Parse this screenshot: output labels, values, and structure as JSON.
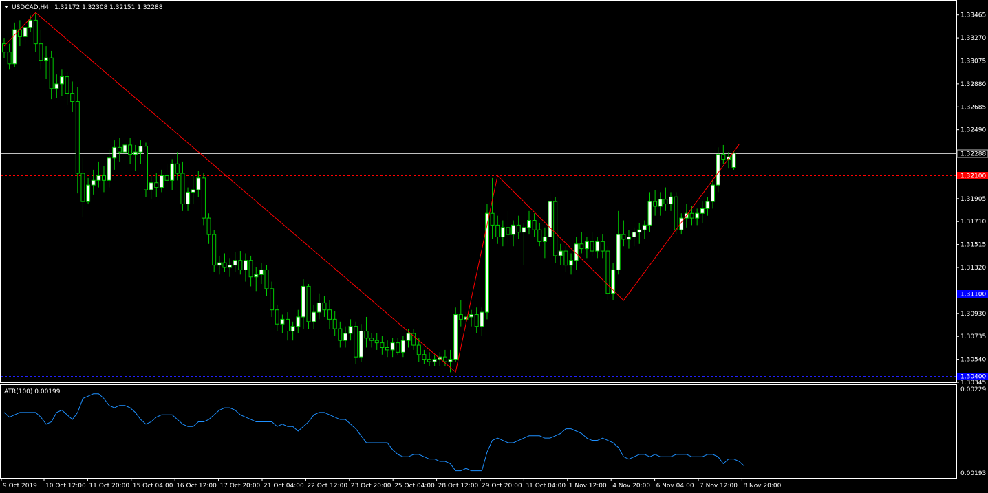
{
  "header": {
    "symbol_timeframe": "USDCAD,H4",
    "ohlc": "1.32172 1.32308 1.32151 1.32288"
  },
  "indicator": {
    "label": "ATR(100) 0.00199"
  },
  "price_levels": {
    "current_bid": "1.32288",
    "red_level": "1.32100",
    "blue_upper": "1.31100",
    "blue_lower": "1.30400"
  },
  "colors": {
    "background": "#000000",
    "frame": "#ffffff",
    "bull_candle": "#ffffff",
    "bear_candle": "#000000",
    "wick": "#00cc00",
    "zigzag": "#ff0000",
    "bid_line": "#c0c0c0",
    "red_level_line": "#ff0000",
    "blue_level_line": "#0000ff",
    "atr_line": "#1e90ff"
  },
  "chart_data": [
    {
      "type": "candlestick",
      "symbol": "USDCAD",
      "timeframe": "H4",
      "price_axis": {
        "range": [
          1.30345,
          1.3358
        ],
        "tick_labels": [
          "1.33465",
          "1.33270",
          "1.33075",
          "1.32880",
          "1.32685",
          "1.32490",
          "1.31905",
          "1.31710",
          "1.31515",
          "1.31320",
          "1.30930",
          "1.30735",
          "1.30540",
          "1.30345"
        ]
      },
      "time_axis": {
        "tick_labels": [
          "9 Oct 2019",
          "10 Oct 12:00",
          "11 Oct 20:00",
          "15 Oct 04:00",
          "16 Oct 12:00",
          "17 Oct 20:00",
          "21 Oct 04:00",
          "22 Oct 12:00",
          "23 Oct 20:00",
          "25 Oct 04:00",
          "28 Oct 12:00",
          "29 Oct 20:00",
          "31 Oct 04:00",
          "1 Nov 12:00",
          "4 Nov 20:00",
          "6 Nov 04:00",
          "7 Nov 12:00",
          "8 Nov 20:00"
        ]
      },
      "candles": [
        [
          1.3322,
          1.3327,
          1.331,
          1.3315
        ],
        [
          1.3315,
          1.3322,
          1.33,
          1.3305
        ],
        [
          1.3305,
          1.334,
          1.3302,
          1.3334
        ],
        [
          1.3334,
          1.3342,
          1.332,
          1.3328
        ],
        [
          1.3328,
          1.3342,
          1.3322,
          1.3336
        ],
        [
          1.3336,
          1.3346,
          1.3332,
          1.3342
        ],
        [
          1.3342,
          1.3348,
          1.3315,
          1.3322
        ],
        [
          1.3322,
          1.3334,
          1.33,
          1.3308
        ],
        [
          1.3308,
          1.332,
          1.3292,
          1.331
        ],
        [
          1.331,
          1.3316,
          1.3275,
          1.3284
        ],
        [
          1.3284,
          1.3296,
          1.3276,
          1.3288
        ],
        [
          1.3288,
          1.33,
          1.3278,
          1.3294
        ],
        [
          1.3294,
          1.3298,
          1.327,
          1.328
        ],
        [
          1.328,
          1.329,
          1.3264,
          1.3273
        ],
        [
          1.3273,
          1.3285,
          1.3195,
          1.3212
        ],
        [
          1.3212,
          1.3225,
          1.3175,
          1.3188
        ],
        [
          1.3188,
          1.3208,
          1.3186,
          1.3202
        ],
        [
          1.3202,
          1.3215,
          1.3194,
          1.3206
        ],
        [
          1.3206,
          1.3222,
          1.32,
          1.321
        ],
        [
          1.321,
          1.3218,
          1.3196,
          1.3206
        ],
        [
          1.3206,
          1.3232,
          1.32,
          1.3225
        ],
        [
          1.3225,
          1.324,
          1.3215,
          1.3234
        ],
        [
          1.3234,
          1.3242,
          1.3222,
          1.323
        ],
        [
          1.323,
          1.324,
          1.3222,
          1.3236
        ],
        [
          1.3236,
          1.3242,
          1.322,
          1.3228
        ],
        [
          1.3228,
          1.3236,
          1.3214,
          1.323
        ],
        [
          1.323,
          1.324,
          1.322,
          1.3235
        ],
        [
          1.3235,
          1.3238,
          1.3192,
          1.3198
        ],
        [
          1.3198,
          1.321,
          1.319,
          1.3204
        ],
        [
          1.3204,
          1.3212,
          1.3192,
          1.32
        ],
        [
          1.32,
          1.3215,
          1.3196,
          1.321
        ],
        [
          1.321,
          1.322,
          1.32,
          1.3206
        ],
        [
          1.3206,
          1.3224,
          1.3198,
          1.322
        ],
        [
          1.322,
          1.323,
          1.3206,
          1.3212
        ],
        [
          1.3212,
          1.3222,
          1.318,
          1.3186
        ],
        [
          1.3186,
          1.32,
          1.318,
          1.3196
        ],
        [
          1.3196,
          1.321,
          1.3186,
          1.3198
        ],
        [
          1.3198,
          1.3214,
          1.3192,
          1.3208
        ],
        [
          1.3208,
          1.3212,
          1.3168,
          1.3174
        ],
        [
          1.3174,
          1.3178,
          1.3152,
          1.316
        ],
        [
          1.316,
          1.3164,
          1.3128,
          1.3134
        ],
        [
          1.3134,
          1.3142,
          1.3126,
          1.3136
        ],
        [
          1.3136,
          1.3144,
          1.3128,
          1.3132
        ],
        [
          1.3132,
          1.314,
          1.3124,
          1.3134
        ],
        [
          1.3134,
          1.3145,
          1.3128,
          1.3138
        ],
        [
          1.3138,
          1.3146,
          1.3126,
          1.313
        ],
        [
          1.313,
          1.3144,
          1.312,
          1.3138
        ],
        [
          1.3138,
          1.3142,
          1.3116,
          1.3124
        ],
        [
          1.3124,
          1.3132,
          1.3112,
          1.3126
        ],
        [
          1.3126,
          1.3136,
          1.3118,
          1.313
        ],
        [
          1.313,
          1.3134,
          1.3108,
          1.3114
        ],
        [
          1.3114,
          1.312,
          1.309,
          1.3096
        ],
        [
          1.3096,
          1.31,
          1.3078,
          1.3084
        ],
        [
          1.3084,
          1.3092,
          1.3076,
          1.3088
        ],
        [
          1.3088,
          1.3094,
          1.307,
          1.3078
        ],
        [
          1.3078,
          1.3086,
          1.307,
          1.3082
        ],
        [
          1.3082,
          1.3096,
          1.3076,
          1.309
        ],
        [
          1.309,
          1.3122,
          1.308,
          1.3116
        ],
        [
          1.3116,
          1.3118,
          1.308,
          1.3086
        ],
        [
          1.3086,
          1.31,
          1.308,
          1.3094
        ],
        [
          1.3094,
          1.311,
          1.3088,
          1.3102
        ],
        [
          1.3102,
          1.3108,
          1.309,
          1.3096
        ],
        [
          1.3096,
          1.3104,
          1.308,
          1.3088
        ],
        [
          1.3088,
          1.3095,
          1.3074,
          1.308
        ],
        [
          1.308,
          1.3086,
          1.3064,
          1.307
        ],
        [
          1.307,
          1.3082,
          1.3064,
          1.3076
        ],
        [
          1.3076,
          1.3088,
          1.307,
          1.3082
        ],
        [
          1.3082,
          1.3086,
          1.305,
          1.3056
        ],
        [
          1.3056,
          1.3084,
          1.3052,
          1.3078
        ],
        [
          1.3078,
          1.309,
          1.3064,
          1.3072
        ],
        [
          1.3072,
          1.3076,
          1.3064,
          1.307
        ],
        [
          1.307,
          1.3076,
          1.3062,
          1.3068
        ],
        [
          1.3068,
          1.3074,
          1.3058,
          1.3064
        ],
        [
          1.3064,
          1.307,
          1.3056,
          1.3062
        ],
        [
          1.3062,
          1.3072,
          1.3056,
          1.3068
        ],
        [
          1.3068,
          1.3072,
          1.3058,
          1.306
        ],
        [
          1.306,
          1.3074,
          1.3056,
          1.307
        ],
        [
          1.307,
          1.308,
          1.3064,
          1.3076
        ],
        [
          1.3076,
          1.308,
          1.3062,
          1.3066
        ],
        [
          1.3066,
          1.3072,
          1.3052,
          1.3058
        ],
        [
          1.3058,
          1.3062,
          1.305,
          1.3054
        ],
        [
          1.3054,
          1.306,
          1.3048,
          1.3052
        ],
        [
          1.3052,
          1.3058,
          1.3048,
          1.3054
        ],
        [
          1.3054,
          1.306,
          1.3048,
          1.3056
        ],
        [
          1.3056,
          1.3062,
          1.3048,
          1.3052
        ],
        [
          1.3052,
          1.3062,
          1.3043,
          1.3054
        ],
        [
          1.3054,
          1.3098,
          1.3052,
          1.3092
        ],
        [
          1.3092,
          1.3104,
          1.3082,
          1.3088
        ],
        [
          1.3088,
          1.3094,
          1.308,
          1.309
        ],
        [
          1.309,
          1.3096,
          1.3082,
          1.3092
        ],
        [
          1.3092,
          1.3098,
          1.3076,
          1.3082
        ],
        [
          1.3082,
          1.3098,
          1.3074,
          1.3094
        ],
        [
          1.3094,
          1.3186,
          1.3088,
          1.3178
        ],
        [
          1.3178,
          1.3208,
          1.3156,
          1.3168
        ],
        [
          1.3168,
          1.3176,
          1.3152,
          1.3158
        ],
        [
          1.3158,
          1.3172,
          1.315,
          1.3166
        ],
        [
          1.3166,
          1.318,
          1.3152,
          1.316
        ],
        [
          1.316,
          1.3172,
          1.315,
          1.3168
        ],
        [
          1.3168,
          1.3176,
          1.3156,
          1.3162
        ],
        [
          1.3162,
          1.317,
          1.3134,
          1.3166
        ],
        [
          1.3166,
          1.318,
          1.316,
          1.3172
        ],
        [
          1.3172,
          1.3178,
          1.3158,
          1.3164
        ],
        [
          1.3164,
          1.317,
          1.315,
          1.3154
        ],
        [
          1.3154,
          1.3166,
          1.314,
          1.3158
        ],
        [
          1.3158,
          1.3196,
          1.315,
          1.3188
        ],
        [
          1.3188,
          1.3192,
          1.3136,
          1.3142
        ],
        [
          1.3142,
          1.3152,
          1.3134,
          1.3146
        ],
        [
          1.3146,
          1.315,
          1.3128,
          1.3134
        ],
        [
          1.3134,
          1.3144,
          1.3126,
          1.3138
        ],
        [
          1.3138,
          1.3158,
          1.313,
          1.3152
        ],
        [
          1.3152,
          1.3162,
          1.3144,
          1.3148
        ],
        [
          1.3148,
          1.3158,
          1.314,
          1.3154
        ],
        [
          1.3154,
          1.3162,
          1.3142,
          1.3146
        ],
        [
          1.3146,
          1.3158,
          1.314,
          1.3154
        ],
        [
          1.3154,
          1.316,
          1.314,
          1.3146
        ],
        [
          1.3146,
          1.315,
          1.3104,
          1.311
        ],
        [
          1.311,
          1.3136,
          1.3104,
          1.313
        ],
        [
          1.313,
          1.318,
          1.3126,
          1.316
        ],
        [
          1.316,
          1.3172,
          1.315,
          1.3156
        ],
        [
          1.3156,
          1.3164,
          1.3148,
          1.3158
        ],
        [
          1.3158,
          1.3166,
          1.315,
          1.3162
        ],
        [
          1.3162,
          1.317,
          1.3152,
          1.3164
        ],
        [
          1.3164,
          1.3172,
          1.3156,
          1.3168
        ],
        [
          1.3168,
          1.3196,
          1.3162,
          1.3188
        ],
        [
          1.3188,
          1.3198,
          1.3176,
          1.3184
        ],
        [
          1.3184,
          1.3196,
          1.3176,
          1.319
        ],
        [
          1.319,
          1.32,
          1.318,
          1.3186
        ],
        [
          1.3186,
          1.3196,
          1.318,
          1.3192
        ],
        [
          1.3192,
          1.3196,
          1.316,
          1.3164
        ],
        [
          1.3164,
          1.3178,
          1.316,
          1.3174
        ],
        [
          1.3174,
          1.3186,
          1.3166,
          1.3178
        ],
        [
          1.3178,
          1.3184,
          1.3168,
          1.3174
        ],
        [
          1.3174,
          1.3182,
          1.3168,
          1.3178
        ],
        [
          1.3178,
          1.3188,
          1.317,
          1.3182
        ],
        [
          1.3182,
          1.3192,
          1.3176,
          1.3188
        ],
        [
          1.3188,
          1.3206,
          1.3182,
          1.3202
        ],
        [
          1.3202,
          1.3234,
          1.3196,
          1.3228
        ],
        [
          1.3228,
          1.3236,
          1.322,
          1.3224
        ],
        [
          1.3224,
          1.323,
          1.3216,
          1.3226
        ],
        [
          1.3217,
          1.3231,
          1.3215,
          1.3229
        ]
      ],
      "zigzag": [
        {
          "bar": 0,
          "price": 1.332
        },
        {
          "bar": 6,
          "price": 1.33485
        },
        {
          "bar": 86,
          "price": 1.30432
        },
        {
          "bar": 94,
          "price": 1.321
        },
        {
          "bar": 118,
          "price": 1.3104
        },
        {
          "bar": 140,
          "price": 1.32365
        }
      ],
      "levels": [
        {
          "price": 1.32288,
          "style": "solid",
          "color": "#c0c0c0"
        },
        {
          "price": 1.321,
          "style": "dashed",
          "color": "#ff0000"
        },
        {
          "price": 1.311,
          "style": "dashed",
          "color": "#0000ff"
        },
        {
          "price": 1.304,
          "style": "dashed",
          "color": "#0000ff"
        }
      ]
    },
    {
      "type": "line",
      "name": "ATR(100)",
      "value_axis": {
        "range": [
          0.00193,
          0.00229
        ],
        "tick_labels": [
          "0.00229",
          "0.00193"
        ]
      },
      "values": [
        0.00219,
        0.00217,
        0.00218,
        0.00219,
        0.00219,
        0.00219,
        0.00219,
        0.00217,
        0.00214,
        0.00215,
        0.00219,
        0.0022,
        0.00218,
        0.00216,
        0.00219,
        0.00225,
        0.00226,
        0.00227,
        0.00227,
        0.00225,
        0.00222,
        0.00221,
        0.00222,
        0.00222,
        0.00221,
        0.00219,
        0.00216,
        0.00214,
        0.00215,
        0.00217,
        0.00218,
        0.00218,
        0.00218,
        0.00216,
        0.00214,
        0.00213,
        0.00213,
        0.00215,
        0.00215,
        0.00216,
        0.00218,
        0.0022,
        0.00221,
        0.00221,
        0.0022,
        0.00218,
        0.00217,
        0.00216,
        0.00215,
        0.00215,
        0.00215,
        0.00215,
        0.00213,
        0.00214,
        0.00213,
        0.00213,
        0.00211,
        0.00213,
        0.00215,
        0.00218,
        0.00219,
        0.00219,
        0.00218,
        0.00217,
        0.00216,
        0.00216,
        0.00214,
        0.00212,
        0.00209,
        0.00206,
        0.00206,
        0.00206,
        0.00206,
        0.00206,
        0.00203,
        0.00201,
        0.002,
        0.002,
        0.00201,
        0.00201,
        0.002,
        0.00199,
        0.00199,
        0.00198,
        0.00198,
        0.00197,
        0.00194,
        0.00194,
        0.00195,
        0.00194,
        0.00194,
        0.00194,
        0.00202,
        0.00207,
        0.00208,
        0.00207,
        0.00206,
        0.00206,
        0.00207,
        0.00208,
        0.00209,
        0.00209,
        0.00209,
        0.00208,
        0.00208,
        0.00209,
        0.0021,
        0.00212,
        0.00212,
        0.00211,
        0.0021,
        0.00208,
        0.00207,
        0.00207,
        0.00208,
        0.00207,
        0.00206,
        0.00204,
        0.002,
        0.00199,
        0.002,
        0.00201,
        0.00201,
        0.002,
        0.00201,
        0.002,
        0.002,
        0.002,
        0.00201,
        0.00201,
        0.00201,
        0.002,
        0.002,
        0.002,
        0.00201,
        0.00201,
        0.002,
        0.00197,
        0.00199,
        0.00199,
        0.00198,
        0.00196
      ]
    }
  ]
}
